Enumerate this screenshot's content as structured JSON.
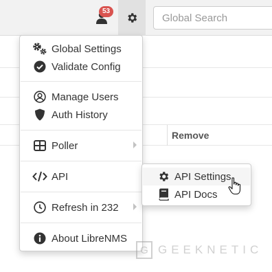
{
  "navbar": {
    "notifications_count": "53",
    "search": {
      "placeholder": "Global Search"
    }
  },
  "table": {
    "remove_header": "Remove"
  },
  "settings_menu": {
    "items": [
      {
        "label": "Global Settings",
        "icon": "cogs-icon"
      },
      {
        "label": "Validate Config",
        "icon": "check-circle-icon"
      },
      {
        "label": "Manage Users",
        "icon": "user-circle-icon"
      },
      {
        "label": "Auth History",
        "icon": "shield-icon"
      },
      {
        "label": "Poller",
        "icon": "table-grid-icon",
        "has_submenu": true
      },
      {
        "label": "API",
        "icon": "code-icon",
        "has_submenu": true
      },
      {
        "label": "Refresh in 232",
        "icon": "clock-icon",
        "has_submenu": true
      },
      {
        "label": "About LibreNMS",
        "icon": "info-circle-icon"
      }
    ]
  },
  "api_submenu": {
    "items": [
      {
        "label": "API Settings",
        "icon": "gear-icon"
      },
      {
        "label": "API Docs",
        "icon": "book-icon"
      }
    ]
  },
  "watermark": {
    "mark": "G",
    "text": "GEEKNETIC"
  },
  "colors": {
    "badge": "#d9534f",
    "icon_dark": "#333333",
    "menu_border": "#cfcfcf"
  }
}
